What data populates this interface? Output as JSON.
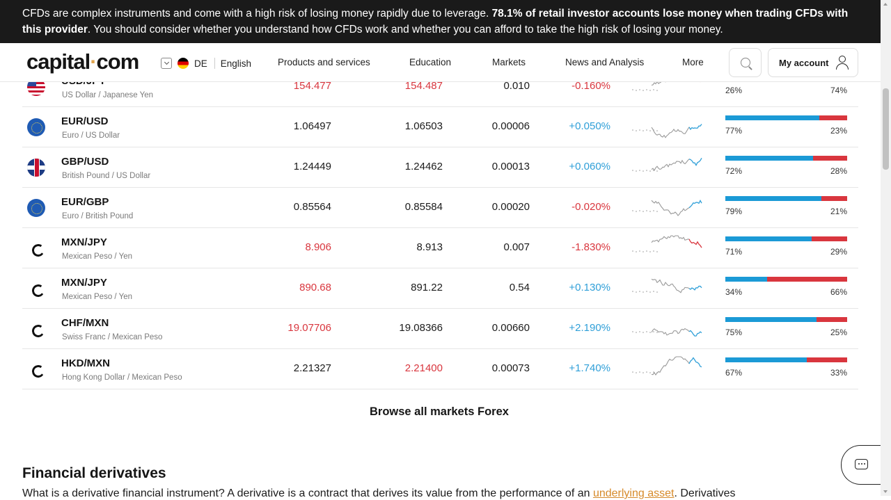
{
  "warning": {
    "text_a": "CFDs are complex instruments and come with a high risk of losing money rapidly due to leverage. ",
    "text_b": "78.1% of retail investor accounts lose money when trading CFDs with this provider",
    "text_c": ". You should consider whether you understand how CFDs work and whether you can afford to take the high risk of losing your money."
  },
  "nav": {
    "logo_a": "capital",
    "logo_dot": "·",
    "logo_b": "com",
    "region": "DE",
    "language": "English",
    "menu": [
      "Products and services",
      "Education",
      "Markets",
      "News and Analysis",
      "More"
    ],
    "account": "My account"
  },
  "rows": [
    {
      "flag": "us",
      "symbol": "USD/JPY",
      "name": "US Dollar / Japanese Yen",
      "sell": "154.477",
      "sell_color": "red",
      "buy": "154.487",
      "buy_color": "red",
      "spread": "0.010",
      "change": "-0.160%",
      "change_color": "red",
      "buy_pct": 26,
      "left": "26%",
      "right": "74%",
      "spark_color": "#d9363e"
    },
    {
      "flag": "eu",
      "symbol": "EUR/USD",
      "name": "Euro / US Dollar",
      "sell": "1.06497",
      "sell_color": "",
      "buy": "1.06503",
      "buy_color": "",
      "spread": "0.00006",
      "change": "+0.050%",
      "change_color": "blue",
      "buy_pct": 77,
      "left": "77%",
      "right": "23%",
      "spark_color": "#2f9fd8"
    },
    {
      "flag": "gb",
      "symbol": "GBP/USD",
      "name": "British Pound / US Dollar",
      "sell": "1.24449",
      "sell_color": "",
      "buy": "1.24462",
      "buy_color": "",
      "spread": "0.00013",
      "change": "+0.060%",
      "change_color": "blue",
      "buy_pct": 72,
      "left": "72%",
      "right": "28%",
      "spark_color": "#2f9fd8"
    },
    {
      "flag": "eu",
      "symbol": "EUR/GBP",
      "name": "Euro / British Pound",
      "sell": "0.85564",
      "sell_color": "",
      "buy": "0.85584",
      "buy_color": "",
      "spread": "0.00020",
      "change": "-0.020%",
      "change_color": "red",
      "buy_pct": 79,
      "left": "79%",
      "right": "21%",
      "spark_color": "#2f9fd8"
    },
    {
      "flag": "cap",
      "symbol": "MXN/JPY",
      "name": "Mexican Peso / Yen",
      "sell": "8.906",
      "sell_color": "red",
      "buy": "8.913",
      "buy_color": "",
      "spread": "0.007",
      "change": "-1.830%",
      "change_color": "red",
      "buy_pct": 71,
      "left": "71%",
      "right": "29%",
      "spark_color": "#d9363e"
    },
    {
      "flag": "cap",
      "symbol": "MXN/JPY",
      "name": "Mexican Peso / Yen",
      "sell": "890.68",
      "sell_color": "red",
      "buy": "891.22",
      "buy_color": "",
      "spread": "0.54",
      "change": "+0.130%",
      "change_color": "blue",
      "buy_pct": 34,
      "left": "34%",
      "right": "66%",
      "spark_color": "#2f9fd8"
    },
    {
      "flag": "cap",
      "symbol": "CHF/MXN",
      "name": "Swiss Franc / Mexican Peso",
      "sell": "19.07706",
      "sell_color": "red",
      "buy": "19.08366",
      "buy_color": "",
      "spread": "0.00660",
      "change": "+2.190%",
      "change_color": "blue",
      "buy_pct": 75,
      "left": "75%",
      "right": "25%",
      "spark_color": "#2f9fd8"
    },
    {
      "flag": "cap",
      "symbol": "HKD/MXN",
      "name": "Hong Kong Dollar / Mexican Peso",
      "sell": "2.21327",
      "sell_color": "",
      "buy": "2.21400",
      "buy_color": "red",
      "spread": "0.00073",
      "change": "+1.740%",
      "change_color": "blue",
      "buy_pct": 67,
      "left": "67%",
      "right": "33%",
      "spark_color": "#2f9fd8"
    }
  ],
  "browse": "Browse all markets Forex",
  "section_title": "Financial derivatives",
  "body": {
    "text_a": "What is a derivative financial instrument? A derivative is a contract that derives its value from the performance of an ",
    "link": "underlying asset",
    "text_b": ". Derivatives"
  }
}
